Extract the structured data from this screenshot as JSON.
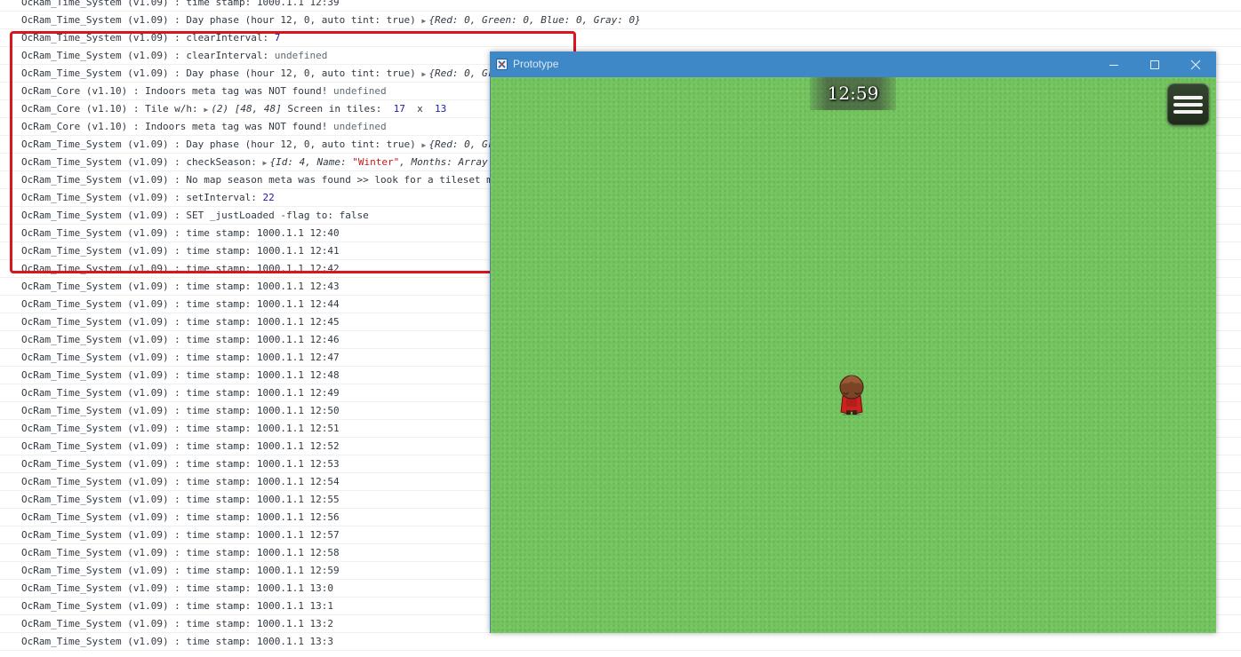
{
  "console": {
    "logs": [
      {
        "parts": [
          {
            "t": "text",
            "v": "OcRam_Time_System (v1.09) : time stamp: 1000.1.1 12:39"
          }
        ]
      },
      {
        "parts": [
          {
            "t": "text",
            "v": "OcRam_Time_System (v1.09) : Day phase (hour 12, 0, auto tint: true) "
          },
          {
            "t": "tri",
            "v": "▶"
          },
          {
            "t": "obj",
            "v": "{Red: "
          },
          {
            "t": "objnum",
            "v": "0"
          },
          {
            "t": "obj",
            "v": ", Green: "
          },
          {
            "t": "objnum",
            "v": "0"
          },
          {
            "t": "obj",
            "v": ", Blue: "
          },
          {
            "t": "objnum",
            "v": "0"
          },
          {
            "t": "obj",
            "v": ", Gray: "
          },
          {
            "t": "objnum",
            "v": "0"
          },
          {
            "t": "obj",
            "v": "}"
          }
        ]
      },
      {
        "parts": [
          {
            "t": "text",
            "v": "OcRam_Time_System (v1.09) : clearInterval: "
          },
          {
            "t": "num",
            "v": "7"
          }
        ]
      },
      {
        "parts": [
          {
            "t": "text",
            "v": "OcRam_Time_System (v1.09) : clearInterval: "
          },
          {
            "t": "undef",
            "v": "undefined"
          }
        ]
      },
      {
        "parts": [
          {
            "t": "text",
            "v": "OcRam_Time_System (v1.09) : Day phase (hour 12, 0, auto tint: true) "
          },
          {
            "t": "tri",
            "v": "▶"
          },
          {
            "t": "obj",
            "v": "{Red: "
          },
          {
            "t": "objnum",
            "v": "0"
          },
          {
            "t": "obj",
            "v": ", Gr"
          }
        ]
      },
      {
        "parts": [
          {
            "t": "text",
            "v": "OcRam_Core (v1.10) : Indoors meta tag was NOT found! "
          },
          {
            "t": "undef",
            "v": "undefined"
          }
        ]
      },
      {
        "parts": [
          {
            "t": "text",
            "v": "OcRam_Core (v1.10) : Tile w/h: "
          },
          {
            "t": "tri",
            "v": "▶"
          },
          {
            "t": "obj",
            "v": "(2) "
          },
          {
            "t": "objnum",
            "v": "[48, 48]"
          },
          {
            "t": "text",
            "v": " Screen in tiles:  "
          },
          {
            "t": "num",
            "v": "17"
          },
          {
            "t": "text",
            "v": "  x  "
          },
          {
            "t": "num",
            "v": "13"
          }
        ]
      },
      {
        "parts": [
          {
            "t": "text",
            "v": "OcRam_Core (v1.10) : Indoors meta tag was NOT found! "
          },
          {
            "t": "undef",
            "v": "undefined"
          }
        ]
      },
      {
        "parts": [
          {
            "t": "text",
            "v": "OcRam_Time_System (v1.09) : Day phase (hour 12, 0, auto tint: true) "
          },
          {
            "t": "tri",
            "v": "▶"
          },
          {
            "t": "obj",
            "v": "{Red: "
          },
          {
            "t": "objnum",
            "v": "0"
          },
          {
            "t": "obj",
            "v": ", Gr"
          }
        ]
      },
      {
        "parts": [
          {
            "t": "text",
            "v": "OcRam_Time_System (v1.09) : checkSeason: "
          },
          {
            "t": "tri",
            "v": "▶"
          },
          {
            "t": "obj",
            "v": "{Id: "
          },
          {
            "t": "objnum",
            "v": "4"
          },
          {
            "t": "obj",
            "v": ", Name: "
          },
          {
            "t": "str",
            "v": "\"Winter\""
          },
          {
            "t": "obj",
            "v": ", Months: Array"
          }
        ]
      },
      {
        "parts": [
          {
            "t": "text",
            "v": "OcRam_Time_System (v1.09) : No map season meta was found >> look for a tileset m"
          }
        ]
      },
      {
        "parts": [
          {
            "t": "text",
            "v": "OcRam_Time_System (v1.09) : setInterval: "
          },
          {
            "t": "num",
            "v": "22"
          }
        ]
      },
      {
        "parts": [
          {
            "t": "text",
            "v": "OcRam_Time_System (v1.09) : SET _justLoaded -flag to: false"
          }
        ]
      },
      {
        "parts": [
          {
            "t": "text",
            "v": "OcRam_Time_System (v1.09) : time stamp: 1000.1.1 12:40"
          }
        ]
      },
      {
        "parts": [
          {
            "t": "text",
            "v": "OcRam_Time_System (v1.09) : time stamp: 1000.1.1 12:41"
          }
        ]
      },
      {
        "parts": [
          {
            "t": "text",
            "v": "OcRam_Time_System (v1.09) : time stamp: 1000.1.1 12:42"
          }
        ]
      },
      {
        "parts": [
          {
            "t": "text",
            "v": "OcRam_Time_System (v1.09) : time stamp: 1000.1.1 12:43"
          }
        ]
      },
      {
        "parts": [
          {
            "t": "text",
            "v": "OcRam_Time_System (v1.09) : time stamp: 1000.1.1 12:44"
          }
        ]
      },
      {
        "parts": [
          {
            "t": "text",
            "v": "OcRam_Time_System (v1.09) : time stamp: 1000.1.1 12:45"
          }
        ]
      },
      {
        "parts": [
          {
            "t": "text",
            "v": "OcRam_Time_System (v1.09) : time stamp: 1000.1.1 12:46"
          }
        ]
      },
      {
        "parts": [
          {
            "t": "text",
            "v": "OcRam_Time_System (v1.09) : time stamp: 1000.1.1 12:47"
          }
        ]
      },
      {
        "parts": [
          {
            "t": "text",
            "v": "OcRam_Time_System (v1.09) : time stamp: 1000.1.1 12:48"
          }
        ]
      },
      {
        "parts": [
          {
            "t": "text",
            "v": "OcRam_Time_System (v1.09) : time stamp: 1000.1.1 12:49"
          }
        ]
      },
      {
        "parts": [
          {
            "t": "text",
            "v": "OcRam_Time_System (v1.09) : time stamp: 1000.1.1 12:50"
          }
        ]
      },
      {
        "parts": [
          {
            "t": "text",
            "v": "OcRam_Time_System (v1.09) : time stamp: 1000.1.1 12:51"
          }
        ]
      },
      {
        "parts": [
          {
            "t": "text",
            "v": "OcRam_Time_System (v1.09) : time stamp: 1000.1.1 12:52"
          }
        ]
      },
      {
        "parts": [
          {
            "t": "text",
            "v": "OcRam_Time_System (v1.09) : time stamp: 1000.1.1 12:53"
          }
        ]
      },
      {
        "parts": [
          {
            "t": "text",
            "v": "OcRam_Time_System (v1.09) : time stamp: 1000.1.1 12:54"
          }
        ]
      },
      {
        "parts": [
          {
            "t": "text",
            "v": "OcRam_Time_System (v1.09) : time stamp: 1000.1.1 12:55"
          }
        ]
      },
      {
        "parts": [
          {
            "t": "text",
            "v": "OcRam_Time_System (v1.09) : time stamp: 1000.1.1 12:56"
          }
        ]
      },
      {
        "parts": [
          {
            "t": "text",
            "v": "OcRam_Time_System (v1.09) : time stamp: 1000.1.1 12:57"
          }
        ]
      },
      {
        "parts": [
          {
            "t": "text",
            "v": "OcRam_Time_System (v1.09) : time stamp: 1000.1.1 12:58"
          }
        ]
      },
      {
        "parts": [
          {
            "t": "text",
            "v": "OcRam_Time_System (v1.09) : time stamp: 1000.1.1 12:59"
          }
        ]
      },
      {
        "parts": [
          {
            "t": "text",
            "v": "OcRam_Time_System (v1.09) : time stamp: 1000.1.1 13:0"
          }
        ]
      },
      {
        "parts": [
          {
            "t": "text",
            "v": "OcRam_Time_System (v1.09) : time stamp: 1000.1.1 13:1"
          }
        ]
      },
      {
        "parts": [
          {
            "t": "text",
            "v": "OcRam_Time_System (v1.09) : time stamp: 1000.1.1 13:2"
          }
        ]
      },
      {
        "parts": [
          {
            "t": "text",
            "v": "OcRam_Time_System (v1.09) : time stamp: 1000.1.1 13:3"
          }
        ]
      }
    ],
    "highlight_color": "#d7161d"
  },
  "game_window": {
    "title": "Prototype",
    "app_icon": "rpg-maker-icon",
    "title_bar_color": "#3f88c8",
    "controls": {
      "minimize_icon": "minimize-icon",
      "maximize_icon": "maximize-icon",
      "close_icon": "close-icon"
    },
    "hud": {
      "clock_time": "12:59",
      "menu_icon": "hamburger-menu-icon"
    },
    "ground_color": "#74c45f",
    "player_icon": "player-character-sprite"
  }
}
